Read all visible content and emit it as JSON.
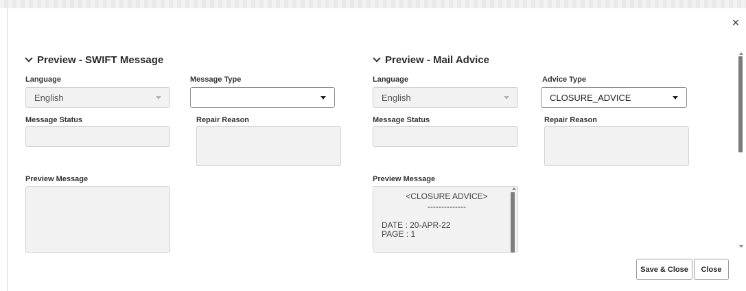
{
  "dialog": {
    "close_icon": "close-icon",
    "close_glyph": "×"
  },
  "swift": {
    "title": "Preview - SWIFT Message",
    "language_label": "Language",
    "language_value": "English",
    "message_type_label": "Message Type",
    "message_type_value": "",
    "message_status_label": "Message Status",
    "message_status_value": "",
    "repair_reason_label": "Repair Reason",
    "repair_reason_value": "",
    "preview_message_label": "Preview Message",
    "preview_message_value": ""
  },
  "mail": {
    "title": "Preview - Mail Advice",
    "language_label": "Language",
    "language_value": "English",
    "advice_type_label": "Advice Type",
    "advice_type_value": "CLOSURE_ADVICE",
    "message_status_label": "Message Status",
    "message_status_value": "",
    "repair_reason_label": "Repair Reason",
    "repair_reason_value": "",
    "preview_message_label": "Preview Message",
    "preview_lines": {
      "heading": "<CLOSURE ADVICE>",
      "rule": "--------------",
      "date": "DATE : 20-APR-22",
      "page": "PAGE : 1"
    }
  },
  "footer": {
    "save_close_label": "Save & Close",
    "close_label": "Close"
  }
}
